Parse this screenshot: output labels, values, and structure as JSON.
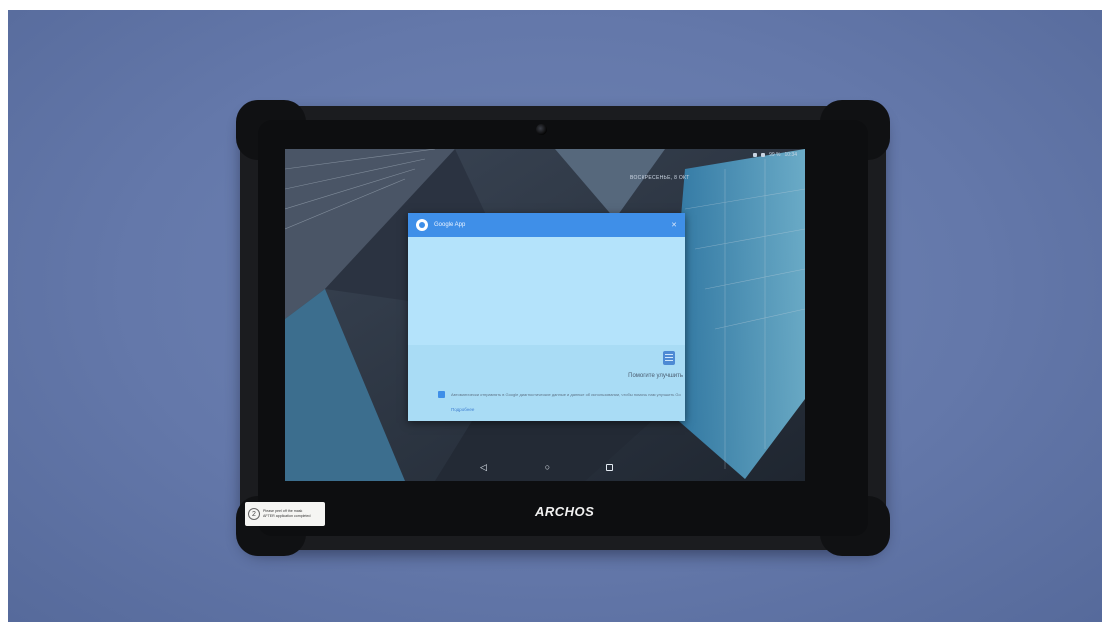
{
  "screen": {
    "clock_widget": "ВОСКРЕСЕНЬЕ, 8 ОКТ",
    "status": {
      "battery": "99 %",
      "time": "10:34"
    },
    "dialog": {
      "title": "Google App",
      "close_glyph": "✕",
      "help_heading": "Помогите улучшить",
      "consent_text": "Автоматически отправлять в Google диагностические данные и данные об использовании, чтобы помочь нам улучшить Google",
      "details_link": "Подробнее"
    },
    "nav": {
      "back_glyph": "◁",
      "home_glyph": "○"
    }
  },
  "device": {
    "brand": "ARCHOS"
  },
  "sticker": {
    "number": "2",
    "lines": [
      "Please peel off the mask",
      "AFTER application completed"
    ]
  }
}
